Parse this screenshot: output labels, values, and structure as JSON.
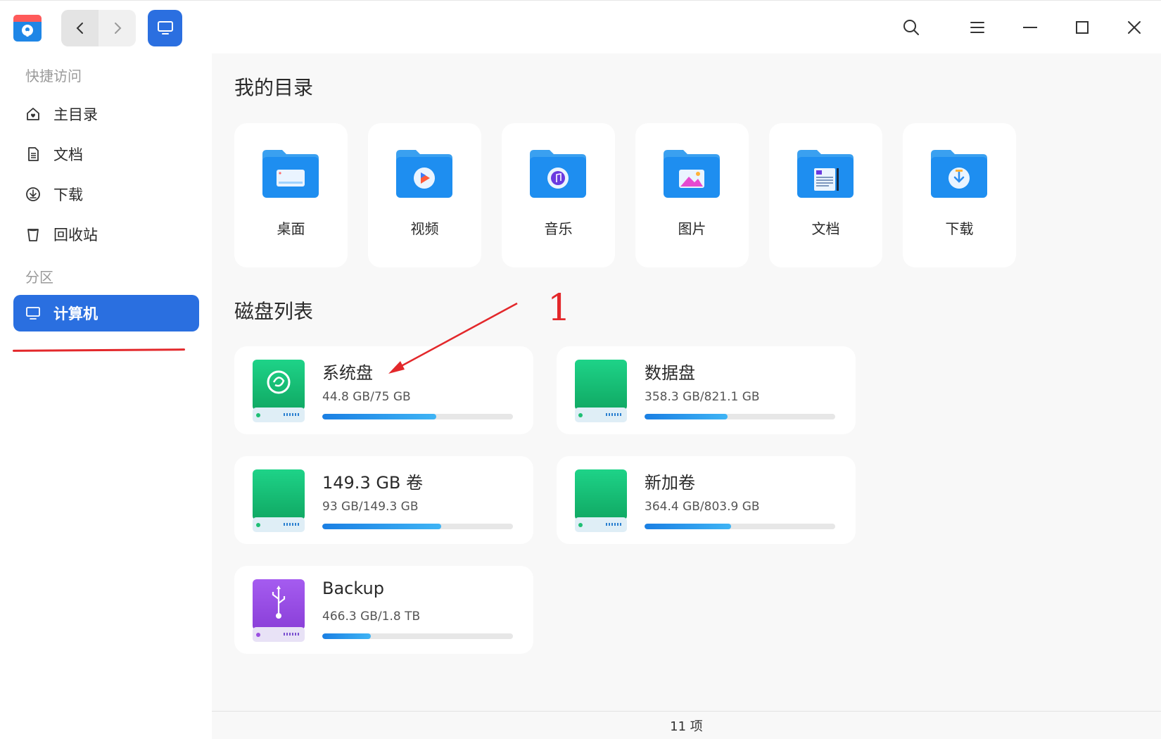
{
  "sidebar": {
    "quick_access_label": "快捷访问",
    "partition_label": "分区",
    "items": [
      {
        "label": "主目录",
        "icon": "home-icon"
      },
      {
        "label": "文档",
        "icon": "document-icon"
      },
      {
        "label": "下载",
        "icon": "download-icon"
      },
      {
        "label": "回收站",
        "icon": "trash-icon"
      }
    ],
    "computer": {
      "label": "计算机",
      "icon": "computer-icon",
      "active": true
    }
  },
  "main": {
    "my_directories_title": "我的目录",
    "directories": [
      {
        "label": "桌面",
        "icon": "desktop-folder-icon"
      },
      {
        "label": "视频",
        "icon": "video-folder-icon"
      },
      {
        "label": "音乐",
        "icon": "music-folder-icon"
      },
      {
        "label": "图片",
        "icon": "pictures-folder-icon"
      },
      {
        "label": "文档",
        "icon": "documents-folder-icon"
      },
      {
        "label": "下载",
        "icon": "downloads-folder-icon"
      }
    ],
    "disk_list_title": "磁盘列表",
    "disks": [
      {
        "name": "系统盘",
        "usage": "44.8 GB/75 GB",
        "used_fraction": 0.597,
        "icon": "system-disk-icon"
      },
      {
        "name": "数据盘",
        "usage": "358.3 GB/821.1 GB",
        "used_fraction": 0.436,
        "icon": "hard-disk-icon"
      },
      {
        "name": "149.3 GB 卷",
        "usage": "93 GB/149.3 GB",
        "used_fraction": 0.623,
        "icon": "hard-disk-icon"
      },
      {
        "name": "新加卷",
        "usage": "364.4 GB/803.9 GB",
        "used_fraction": 0.453,
        "icon": "hard-disk-icon"
      },
      {
        "name": "Backup",
        "usage": "466.3 GB/1.8 TB",
        "used_fraction": 0.253,
        "icon": "usb-disk-icon"
      }
    ]
  },
  "annotation": {
    "number": "1"
  },
  "status": {
    "item_count": "11 项"
  },
  "colors": {
    "accent": "#2a6fe0",
    "annotation": "#e3282b",
    "disk_green": "#1fbf74",
    "usb_purple": "#9b4fe0"
  }
}
